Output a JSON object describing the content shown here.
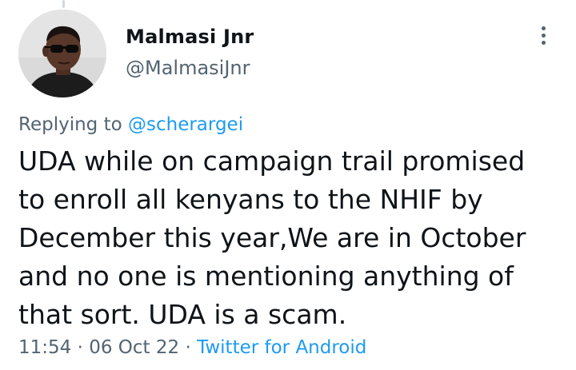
{
  "author": {
    "name": "Malmasi  Jnr",
    "handle": "@MalmasiJnr"
  },
  "reply": {
    "prefix": "Replying to ",
    "target": "@scherargei"
  },
  "tweet": {
    "lines": [
      "UDA while on campaign trail promised",
      "to enroll all kenyans to the NHIF by",
      "December this year,We are in October",
      "and no one is mentioning anything of",
      "that sort. UDA is a scam."
    ]
  },
  "meta": {
    "time": "11:54",
    "separator": " · ",
    "date": "06 Oct 22",
    "source": "Twitter for Android"
  },
  "icons": {
    "more": "more-vertical-icon",
    "avatar": "avatar"
  },
  "colors": {
    "link": "#1d9bf0",
    "secondary_text": "#536471",
    "primary_text": "#0f1419"
  }
}
